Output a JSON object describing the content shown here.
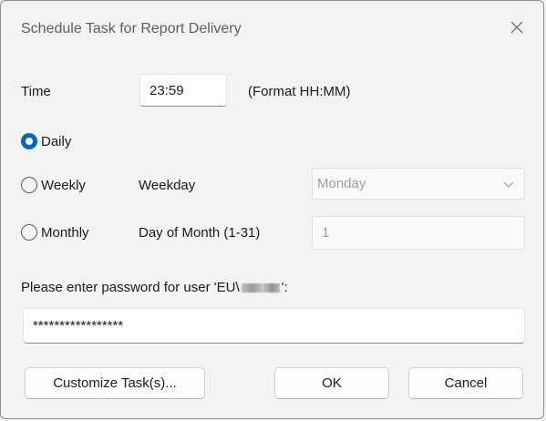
{
  "window": {
    "title": "Schedule Task for Report Delivery",
    "close_icon": "close-icon"
  },
  "time": {
    "label": "Time",
    "value": "23:59",
    "format_hint": "(Format HH:MM)"
  },
  "frequency": {
    "selected": "Daily",
    "daily_label": "Daily",
    "weekly_label": "Weekly",
    "monthly_label": "Monthly"
  },
  "weekday": {
    "label": "Weekday",
    "selected": "Monday"
  },
  "day_of_month": {
    "label": "Day of Month (1-31)",
    "value": "1"
  },
  "password": {
    "prompt_prefix": "Please enter password for user 'EU\\",
    "prompt_suffix": "':",
    "value": "*****************"
  },
  "buttons": {
    "customize_label": "Customize Task(s)...",
    "ok_label": "OK",
    "cancel_label": "Cancel"
  },
  "colors": {
    "accent": "#0067c0",
    "background": "#f3f3f3"
  }
}
